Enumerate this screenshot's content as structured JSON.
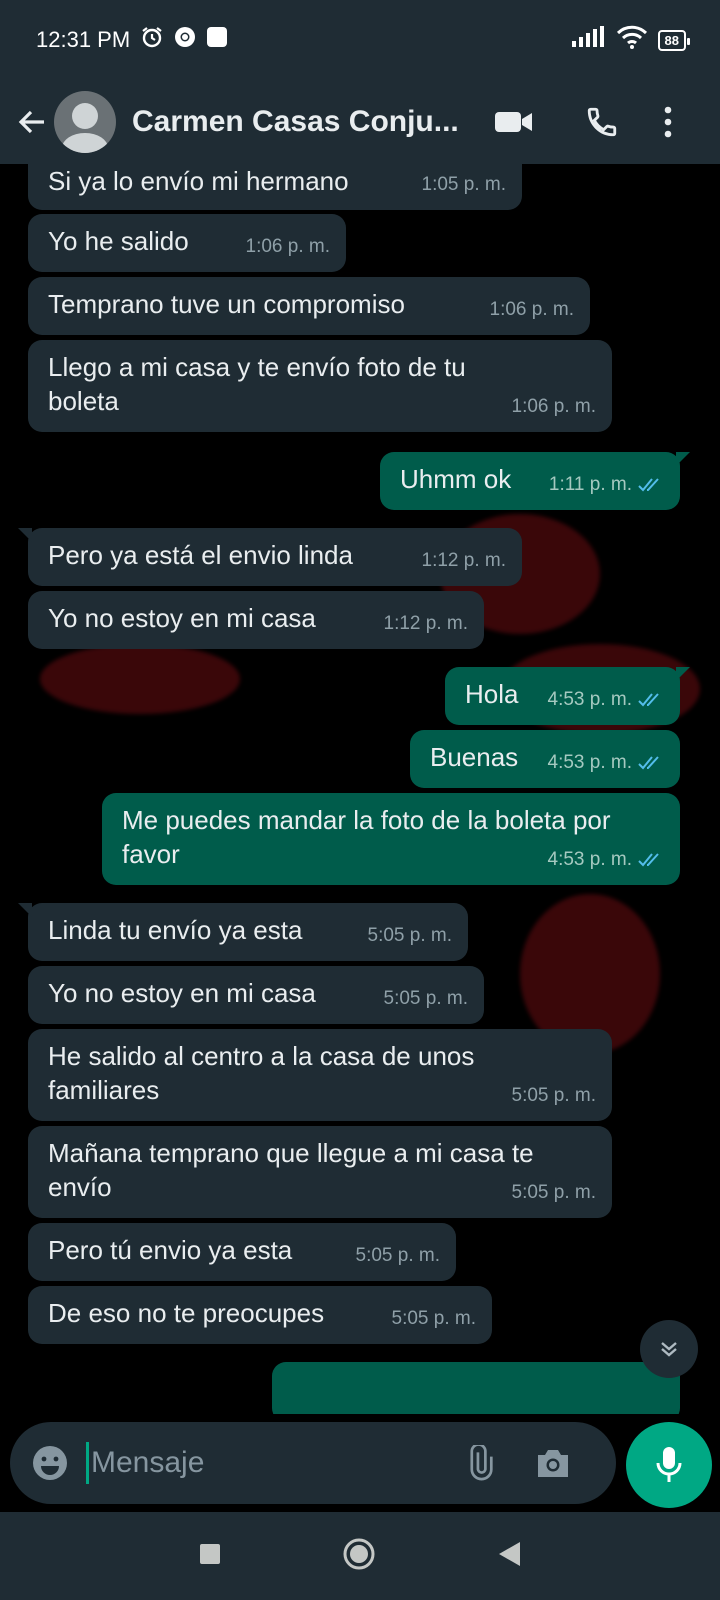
{
  "status_bar": {
    "time": "12:31 PM",
    "battery": "88"
  },
  "header": {
    "contact_name": "Carmen Casas Conju..."
  },
  "messages": [
    {
      "dir": "in",
      "text": "Si ya lo envío mi hermano",
      "time": "1:05 p. m."
    },
    {
      "dir": "in",
      "text": "Yo he salido",
      "time": "1:06 p. m."
    },
    {
      "dir": "in",
      "text": "Temprano tuve un compromiso",
      "time": "1:06 p. m."
    },
    {
      "dir": "in",
      "text": "Llego a mi casa y te envío foto de tu boleta",
      "time": "1:06 p. m."
    },
    {
      "dir": "out",
      "text": "Uhmm ok",
      "time": "1:11 p. m."
    },
    {
      "dir": "in",
      "text": "Pero ya está el envio linda",
      "time": "1:12 p. m."
    },
    {
      "dir": "in",
      "text": "Yo no estoy en mi casa",
      "time": "1:12 p. m."
    },
    {
      "dir": "out",
      "text": "Hola",
      "time": "4:53 p. m."
    },
    {
      "dir": "out",
      "text": "Buenas",
      "time": "4:53 p. m."
    },
    {
      "dir": "out",
      "text": "Me puedes mandar la foto de la boleta por favor",
      "time": "4:53 p. m."
    },
    {
      "dir": "in",
      "text": "Linda tu envío ya esta",
      "time": "5:05 p. m."
    },
    {
      "dir": "in",
      "text": "Yo no estoy en mi casa",
      "time": "5:05 p. m."
    },
    {
      "dir": "in",
      "text": "He salido al centro a la casa de unos familiares",
      "time": "5:05 p. m."
    },
    {
      "dir": "in",
      "text": "Mañana temprano que llegue a mi casa te envío",
      "time": "5:05 p. m."
    },
    {
      "dir": "in",
      "text": "Pero tú envio ya esta",
      "time": "5:05 p. m."
    },
    {
      "dir": "in",
      "text": "De eso no te preocupes",
      "time": "5:05 p. m."
    }
  ],
  "composer": {
    "placeholder": "Mensaje"
  },
  "colors": {
    "incoming": "#1f2c34",
    "outgoing": "#005c4b",
    "accent": "#00a884",
    "read_ticks": "#53bdeb"
  },
  "icons": {
    "back": "arrow-left-icon",
    "video": "video-camera-icon",
    "call": "phone-icon",
    "menu": "more-vertical-icon",
    "emoji": "emoji-icon",
    "attach": "paperclip-icon",
    "camera": "camera-icon",
    "mic": "microphone-icon",
    "scroll": "double-chevron-down-icon"
  }
}
